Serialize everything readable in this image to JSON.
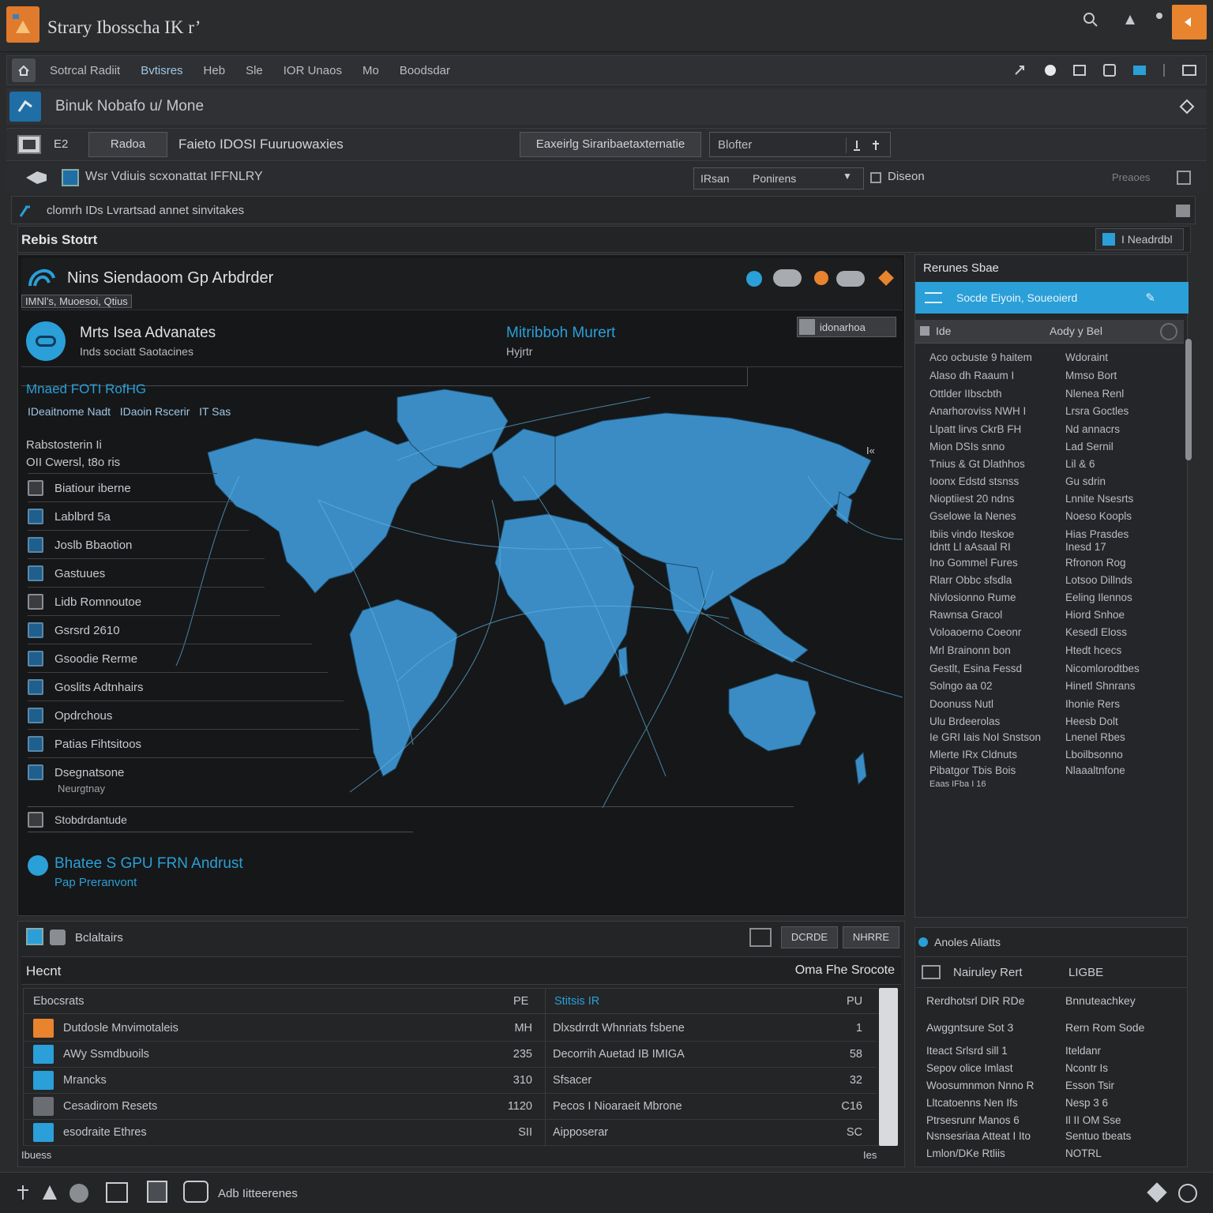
{
  "app": {
    "title": "Strary Ibosscha IK r’"
  },
  "menubar": {
    "items": [
      "Sotrcal Radiit",
      "Bvtisres",
      "Heb",
      "Sle",
      "IOR Unaos",
      "Mo",
      "Boodsdar"
    ]
  },
  "document": {
    "title": "Binuk Nobafo u/ Mone"
  },
  "toolbar1": {
    "left_label": "Radoa",
    "path": "Faieto IDOSI Fuuruowaxies",
    "button_label": "Eaxeirlg Siraribaetaxternatie",
    "search_value": "Blofter"
  },
  "toolbar2": {
    "label": "Wsr Vdiuis scxonattat IFFNLRY",
    "select_label": "IRsan",
    "select_value": "Ponirens",
    "checkbox_label": "Diseon",
    "right_label": "Preaoes"
  },
  "panel_header": {
    "label": "clomrh IDs Lvrartsad annet sinvitakes"
  },
  "panel_sub": {
    "label": "Rebis Stotrt",
    "right_label": "I Neadrdbl"
  },
  "map_panel": {
    "title": "Nins Siendaoom Gp Arbdrder",
    "subtitle": "IMNl’s, Muoesoi, Qtius",
    "profile_name": "Mrts Isea Advanates",
    "profile_sub": "Inds sociatt Saotacines",
    "link_title": "Mitribboh Murert",
    "link_sub": "Hyjrtr",
    "badge": "idonarhoa",
    "section_title": "Mnaed FOTI RofHG",
    "section_sub": "IDeaitnome Nadt   IDaoin Rscerir   IT Sas",
    "list_header_1": "Rabstosterin Ii",
    "list_header_2": "OII Cwersl, t8o ris",
    "side_items": [
      "Biatiour iberne",
      "Lablbrd 5a",
      "Joslb Bbaotion",
      "Gastuues",
      "Lidb Romnoutoe",
      "Gsrsrd 2610",
      "Gsoodie Rerme",
      "Goslits Adtnhairs",
      "Opdrchous",
      "Patias Fihtsitoos",
      "Dsegnatsone",
      "Stobdrdantude"
    ],
    "side_item_sub": "Neurgtnay",
    "footer_title": "Bhatee S GPU FRN Andrust",
    "footer_sub": "Pap Preranvont",
    "corner_mark": "I«"
  },
  "right_panel": {
    "title": "Rerunes Sbae",
    "active_item": "Socde Eiyoin, Soueoierd",
    "col1": "Ide",
    "col2": "Aody y Bel",
    "rows": [
      [
        "Aco ocbuste 9 haitem",
        "Wdoraint"
      ],
      [
        "Alaso dh Raaum I",
        "Mmso Bort"
      ],
      [
        "Ottlder IIbscbth",
        "Nlenea Renl"
      ],
      [
        "Anarhoroviss NWH I",
        "Lrsra Goctles"
      ],
      [
        "Llpatt lirvs CkrB FH",
        "Nd annacrs"
      ],
      [
        "Mion DSIs snno",
        "Lad Sernil"
      ],
      [
        "Tnius & Gt Dlathhos",
        "Lil & 6"
      ],
      [
        "Ioonx Edstd stsnss",
        "Gu sdrin"
      ],
      [
        "Nioptiiest 20 ndns",
        "Lnnite Nsesrts"
      ],
      [
        "Gselowe la Nenes",
        "Noeso Koopls"
      ],
      [
        "Ibiis vindo Iteskoe",
        "Hias Prasdes"
      ],
      [
        "Idntt Ll aAsaal RI",
        "Inesd 17"
      ],
      [
        "Ino Gommel Fures",
        "Rfronon Rog"
      ],
      [
        "Rlarr Obbc sfsdla",
        "Lotsoo Dillnds"
      ],
      [
        "Nivlosionno Rume",
        "Eeling Ilennos"
      ],
      [
        "Rawnsa Gracol",
        "Hiord Snhoe"
      ],
      [
        "Voloaoerno Coeonr",
        "Kesedl Eloss"
      ],
      [
        "Mrl Brainonn bon",
        "Htedt hcecs"
      ],
      [
        "Gestlt, Esina Fessd",
        "Nicomlorodtbes"
      ],
      [
        "Solngo aa 02",
        "Hinetl Shnrans"
      ],
      [
        "Doonuss Nutl",
        "Ihonie Rers"
      ],
      [
        "Ulu Brdeerolas",
        "Heesb Dolt"
      ],
      [
        "Ie GRI Iais NoI Snstson",
        "Lnenel Rbes"
      ],
      [
        "Mlerte IRx Cldnuts",
        "Lboilbsonno"
      ],
      [
        "Pibatgor Tbis Bois",
        "Nlaaaltnfone"
      ],
      [
        "Eaas IFba I 16",
        ""
      ]
    ]
  },
  "bottom_panel": {
    "tab_label": "Bclaltairs",
    "btn1": "DCRDE",
    "btn2": "NHRRE",
    "title": "Hecnt",
    "right_title": "Oma Fhe Srocote",
    "col_left": "Ebocsrats",
    "col_left_val": "PE",
    "col_mid": "Stitsis IR",
    "col_right_val": "PU",
    "rows": [
      [
        "Dutdosle Mnvimotaleis",
        "MH",
        "Dlxsdrrdt Whnriats fsbene",
        "1"
      ],
      [
        "AWy Ssmdbuoils",
        "235",
        "Decorrih Auetad IB IMIGA",
        "58"
      ],
      [
        "Mrancks",
        "310",
        "Sfsacer",
        "32"
      ],
      [
        "Cesadirom Resets",
        "1120",
        "Pecos I Nioaraeit Mbrone",
        "C16"
      ],
      [
        "esodraite Ethres",
        "SII",
        "Aipposerar",
        "SC"
      ]
    ],
    "footer_left": "Ibuess",
    "footer_right": "Ies"
  },
  "alerts_panel": {
    "title": "Anoles Aliatts",
    "head_left": "Nairuley Rert",
    "head_right": "LIGBE",
    "rows": [
      [
        "Rerdhotsrl DIR RDe",
        "Bnnuteachkey"
      ],
      [
        "Awggntsure Sot 3",
        "Rern Rom Sode"
      ],
      [
        "Iteact Srlsrd sill 1",
        "Iteldanr"
      ],
      [
        "Sepov olice Imlast",
        "Ncontr Is"
      ],
      [
        "Woosumnmon Nnno R",
        "Esson Tsir"
      ],
      [
        "Lltcatoenns Nen Ifs",
        "Nesp 3 6"
      ],
      [
        "Ptrsesrunr Manos 6",
        "Il II OM Sse"
      ],
      [
        "Nsnsesriaa Atteat I Ito",
        "Sentuo tbeats"
      ],
      [
        "Lmlon/DKe Rtliis",
        "NOTRL"
      ]
    ]
  },
  "statusbar": {
    "label": "Adb Iitteerenes"
  },
  "colors": {
    "accent_orange": "#e8832e",
    "accent_blue": "#2a9fd8",
    "map_land": "#3b8cc4",
    "panel_dark": "#161718"
  }
}
